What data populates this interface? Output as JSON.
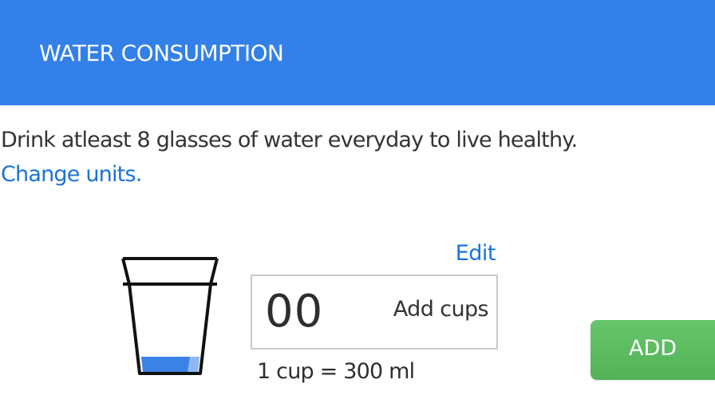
{
  "header": {
    "title": "WATER CONSUMPTION",
    "color": "#3380e8"
  },
  "intro": {
    "text": "Drink atleast 8 glasses of water everyday to live healthy.",
    "change_units_link": "Change units."
  },
  "tracker": {
    "edit_label": "Edit",
    "cups_value": "00",
    "cups_label": "Add cups",
    "conversion": "1 cup  =  300 ml",
    "glass_icon": "water-glass-icon",
    "glass_fill_fraction": 0.15
  },
  "actions": {
    "add_label": "ADD",
    "add_color": "#5cbb60"
  },
  "colors": {
    "link": "#1a73d9",
    "water": "#3b82e6"
  }
}
